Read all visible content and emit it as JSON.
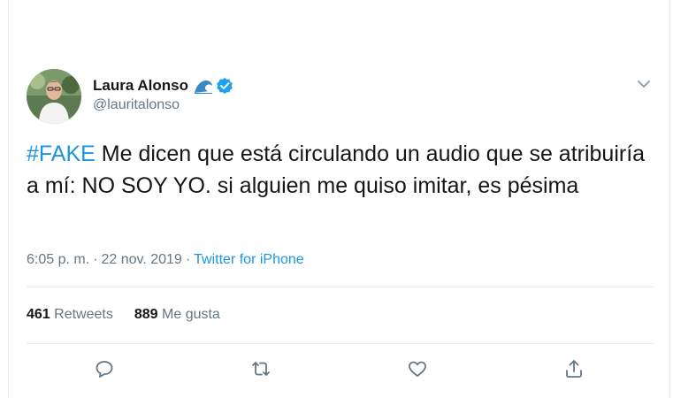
{
  "author": {
    "name": "Laura Alonso",
    "handle": "@lauritalonso",
    "icons": [
      "wave-emoji-icon",
      "verified-badge-icon"
    ]
  },
  "tweet": {
    "hashtag": "#FAKE",
    "text": " Me dicen que está circulando un audio que se atribuiría a mí: NO SOY YO. si alguien me quiso imitar, es pésima"
  },
  "meta": {
    "time": "6:05 p. m.",
    "separator": "·",
    "date": "22 nov. 2019",
    "source": "Twitter for iPhone"
  },
  "stats": {
    "retweets_count": "461",
    "retweets_label": "Retweets",
    "likes_count": "889",
    "likes_label": "Me gusta"
  },
  "actions": [
    "reply-icon",
    "retweet-icon",
    "like-icon",
    "share-icon"
  ],
  "colors": {
    "link": "#1b95e0",
    "text": "#14171a",
    "muted": "#657786",
    "divider": "#e6ecf0",
    "verified": "#1da1f2"
  }
}
